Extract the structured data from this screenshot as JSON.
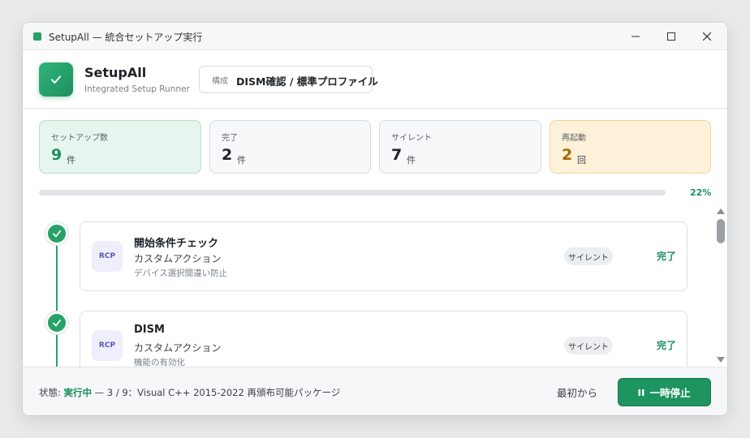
{
  "window": {
    "title": "SetupAll — 統合セットアップ実行"
  },
  "header": {
    "app_name": "SetupAll",
    "app_subtitle": "Integrated Setup Runner",
    "config_label": "構成",
    "config_value": "DISM確認 / 標準プロファイル"
  },
  "stats": [
    {
      "label": "セットアップ数",
      "value": "9",
      "unit": "件",
      "accent": "#1e8f5e"
    },
    {
      "label": "完了",
      "value": "2",
      "unit": "件"
    },
    {
      "label": "サイレント",
      "value": "7",
      "unit": "件"
    },
    {
      "label": "再起動",
      "value": "2",
      "unit": "回",
      "accent": "#a66a00"
    }
  ],
  "progress": {
    "percent": 22,
    "label": "22%"
  },
  "steps": [
    {
      "icon": "check-icon",
      "badge_icon": "RCP",
      "title": "開始条件チェック",
      "type": "カスタムアクション",
      "note": "デバイス選択間違い防止",
      "mode": "サイレント",
      "status": "完了"
    },
    {
      "icon": "check-icon",
      "badge_icon": "RCP",
      "title": "DISM",
      "type": "カスタムアクション",
      "note": "機能の有効化",
      "mode": "サイレント",
      "status": "完了"
    }
  ],
  "footer": {
    "status_prefix": "状態: ",
    "status_state": "実行中",
    "status_detail": " — 3 / 9：Visual C++ 2015-2022 再頒布可能パッケージ",
    "restart_label": "最初から",
    "pause_label": "一時停止"
  },
  "colors": {
    "accent": "#26a269",
    "pause_button": "#1e9460",
    "warning": "#a66a00"
  }
}
